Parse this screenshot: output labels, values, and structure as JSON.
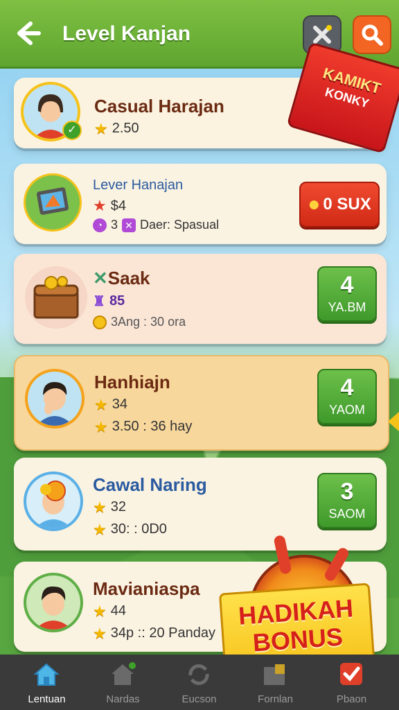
{
  "header": {
    "title": "Level Kanjan"
  },
  "ribbon": {
    "line1": "KAMIKT",
    "line2": "KONKY"
  },
  "cards": [
    {
      "name": "Casual Harajan",
      "rating": "2.50"
    },
    {
      "name": "Lever Hanajan",
      "line1": "$4",
      "line2_num": "3",
      "line2_text": "Daer: Spasual",
      "button": "0 SUX"
    },
    {
      "name": "Saak",
      "line1": "85",
      "line2": "3Ang : 30 ora",
      "btn_num": "4",
      "btn_unit": "YA.BM"
    },
    {
      "name": "Hanhiajn",
      "line1": "34",
      "line2": "3.50 : 36 hay",
      "btn_num": "4",
      "btn_unit": "YAOM"
    },
    {
      "name": "Cawal Naring",
      "line1": "32",
      "line2": "30: : 0D0",
      "btn_num": "3",
      "btn_unit": "SAOM"
    },
    {
      "name": "Mavianiaspa",
      "line1": "44",
      "line2": "34p :: 20 Panday"
    }
  ],
  "bonus": {
    "line1": "HADIKAH",
    "line2": "BONUS"
  },
  "nav": [
    {
      "label": "Lentuan",
      "icon": "home-icon"
    },
    {
      "label": "Nardas",
      "icon": "house-badge-icon"
    },
    {
      "label": "Eucson",
      "icon": "refresh-icon"
    },
    {
      "label": "Fornlan",
      "icon": "folder-icon"
    },
    {
      "label": "Pbaon",
      "icon": "check-badge-icon"
    }
  ],
  "colors": {
    "header": "#6ab13a",
    "green_button": "#4aa632",
    "red_button": "#e13b22",
    "star": "#f5b800"
  }
}
